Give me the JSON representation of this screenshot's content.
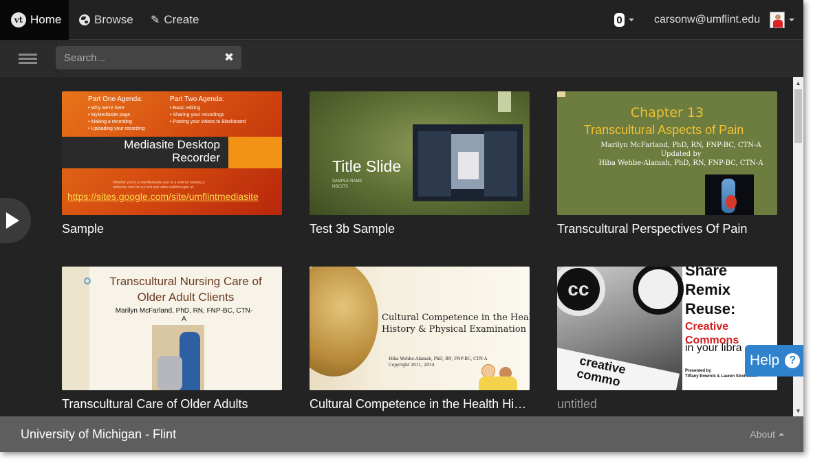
{
  "nav": {
    "home": "Home",
    "browse": "Browse",
    "create": "Create",
    "logo_text": "vt",
    "notifications_count": "0",
    "user_email": "carsonw@umflint.edu"
  },
  "search": {
    "placeholder": "Search..."
  },
  "cards": [
    {
      "title": "Sample",
      "slide": {
        "agenda1_title": "Part One Agenda:",
        "agenda1_items": [
          "• Why we're here",
          "• MyMediasite page",
          "• Making a recording",
          "• Uploading your recording"
        ],
        "agenda2_title": "Part Two Agenda:",
        "agenda2_items": [
          "• Basic editing",
          "• Sharing your recordings",
          "• Posting your videos to Blackboard"
        ],
        "heading_line1": "Mediasite Desktop",
        "heading_line2": "Recorder",
        "small_line1": "Whether you're a new Mediasite user or a veteran seeking a",
        "small_line2": "refresher, look for our text and video walkthroughs at:",
        "link": "https://sites.google.com/site/umflintmediasite"
      }
    },
    {
      "title": "Test 3b Sample",
      "slide": {
        "heading": "Title Slide",
        "sub1": "SAMPLE NAME",
        "sub2": "NSC373"
      }
    },
    {
      "title": "Transcultural Perspectives Of Pain",
      "slide": {
        "line1": "Chapter 13",
        "line2": "Transcultural Aspects of Pain",
        "line3": "Marilyn McFarland, PhD, RN, FNP-BC, CTN-A",
        "line4": "Updated by",
        "line5": "Hiba Wehbe-Alamah, PhD, RN, FNP-BC, CTN-A"
      }
    },
    {
      "title": "Transcultural Care of Older Adults",
      "slide": {
        "line1": "Transcultural Nursing Care of",
        "line2": "Older Adult Clients",
        "line3": "Marilyn McFarland, PhD, RN, FNP-BC, CTN-",
        "line4": "A"
      }
    },
    {
      "title": "Cultural Competence in the Health History & Physical Examination",
      "slide": {
        "line1": "Cultural Competence in the Health",
        "line2": "History & Physical Examination",
        "line3": "Hiba Wehbe-Alamah, PhD, RN, FNP-BC, CTN-A",
        "line4": "Copyright 2011, 2014"
      }
    },
    {
      "title": "untitled",
      "slide": {
        "line1": "Share",
        "line2": "Remix",
        "line3": "Reuse:",
        "line4": "Creative",
        "line5": "Commons",
        "line6": "in your libra",
        "line7": "Presented by",
        "line8": "Tiffany Emerick & Lauren Strohecker",
        "cc_text1": "creative",
        "cc_text2": "commo",
        "cc_badge": "cc"
      }
    }
  ],
  "help": {
    "label": "Help",
    "icon": "?"
  },
  "footer": {
    "org": "University of Michigan - Flint",
    "about": "About"
  },
  "colors": {
    "accent": "#2f82cc",
    "navbar": "#222222",
    "footer": "#5e5e5e",
    "background": "#232323"
  }
}
